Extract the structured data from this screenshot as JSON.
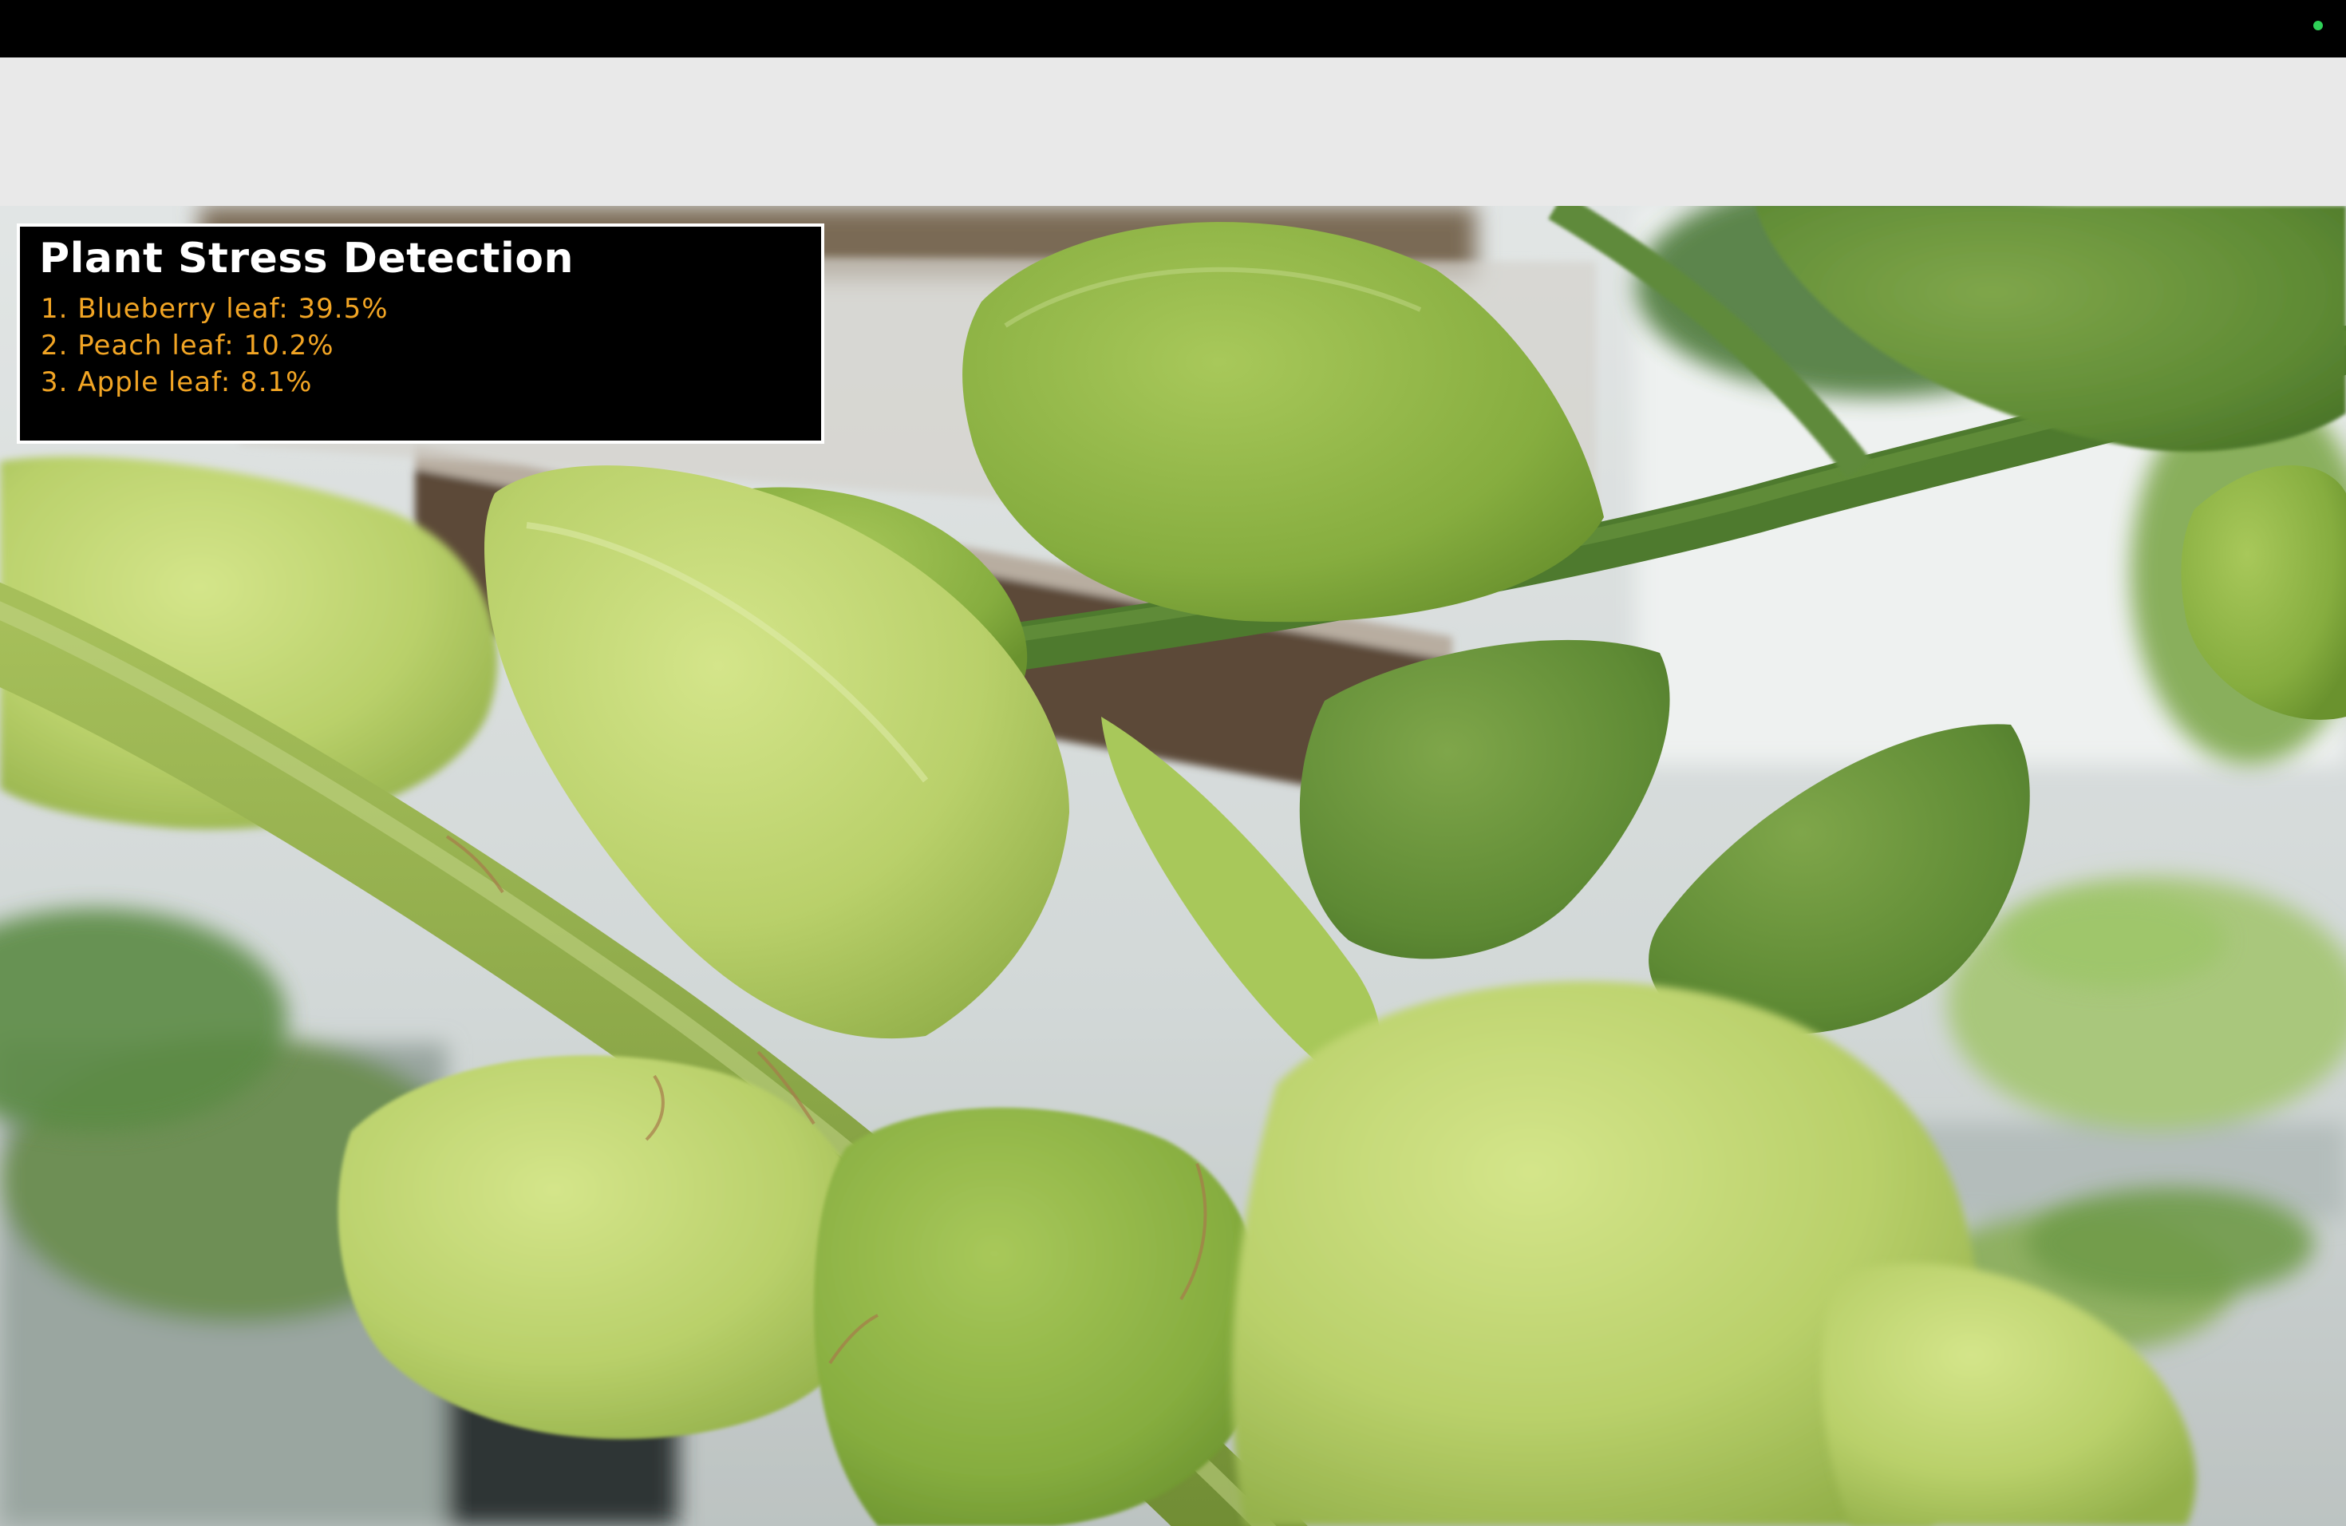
{
  "status": {
    "camera_indicator_color": "#2fd158"
  },
  "camera_feed": {
    "subject": "plant-leaves"
  },
  "overlay": {
    "title": "Plant Stress Detection",
    "text_color": "#f2a524",
    "predictions": [
      {
        "text": "1. Blueberry leaf: 39.5%",
        "label": "Blueberry leaf",
        "confidence": 39.5
      },
      {
        "text": "2. Peach leaf: 10.2%",
        "label": "Peach leaf",
        "confidence": 10.2
      },
      {
        "text": "3. Apple leaf: 8.1%",
        "label": "Apple leaf",
        "confidence": 8.1
      }
    ]
  }
}
